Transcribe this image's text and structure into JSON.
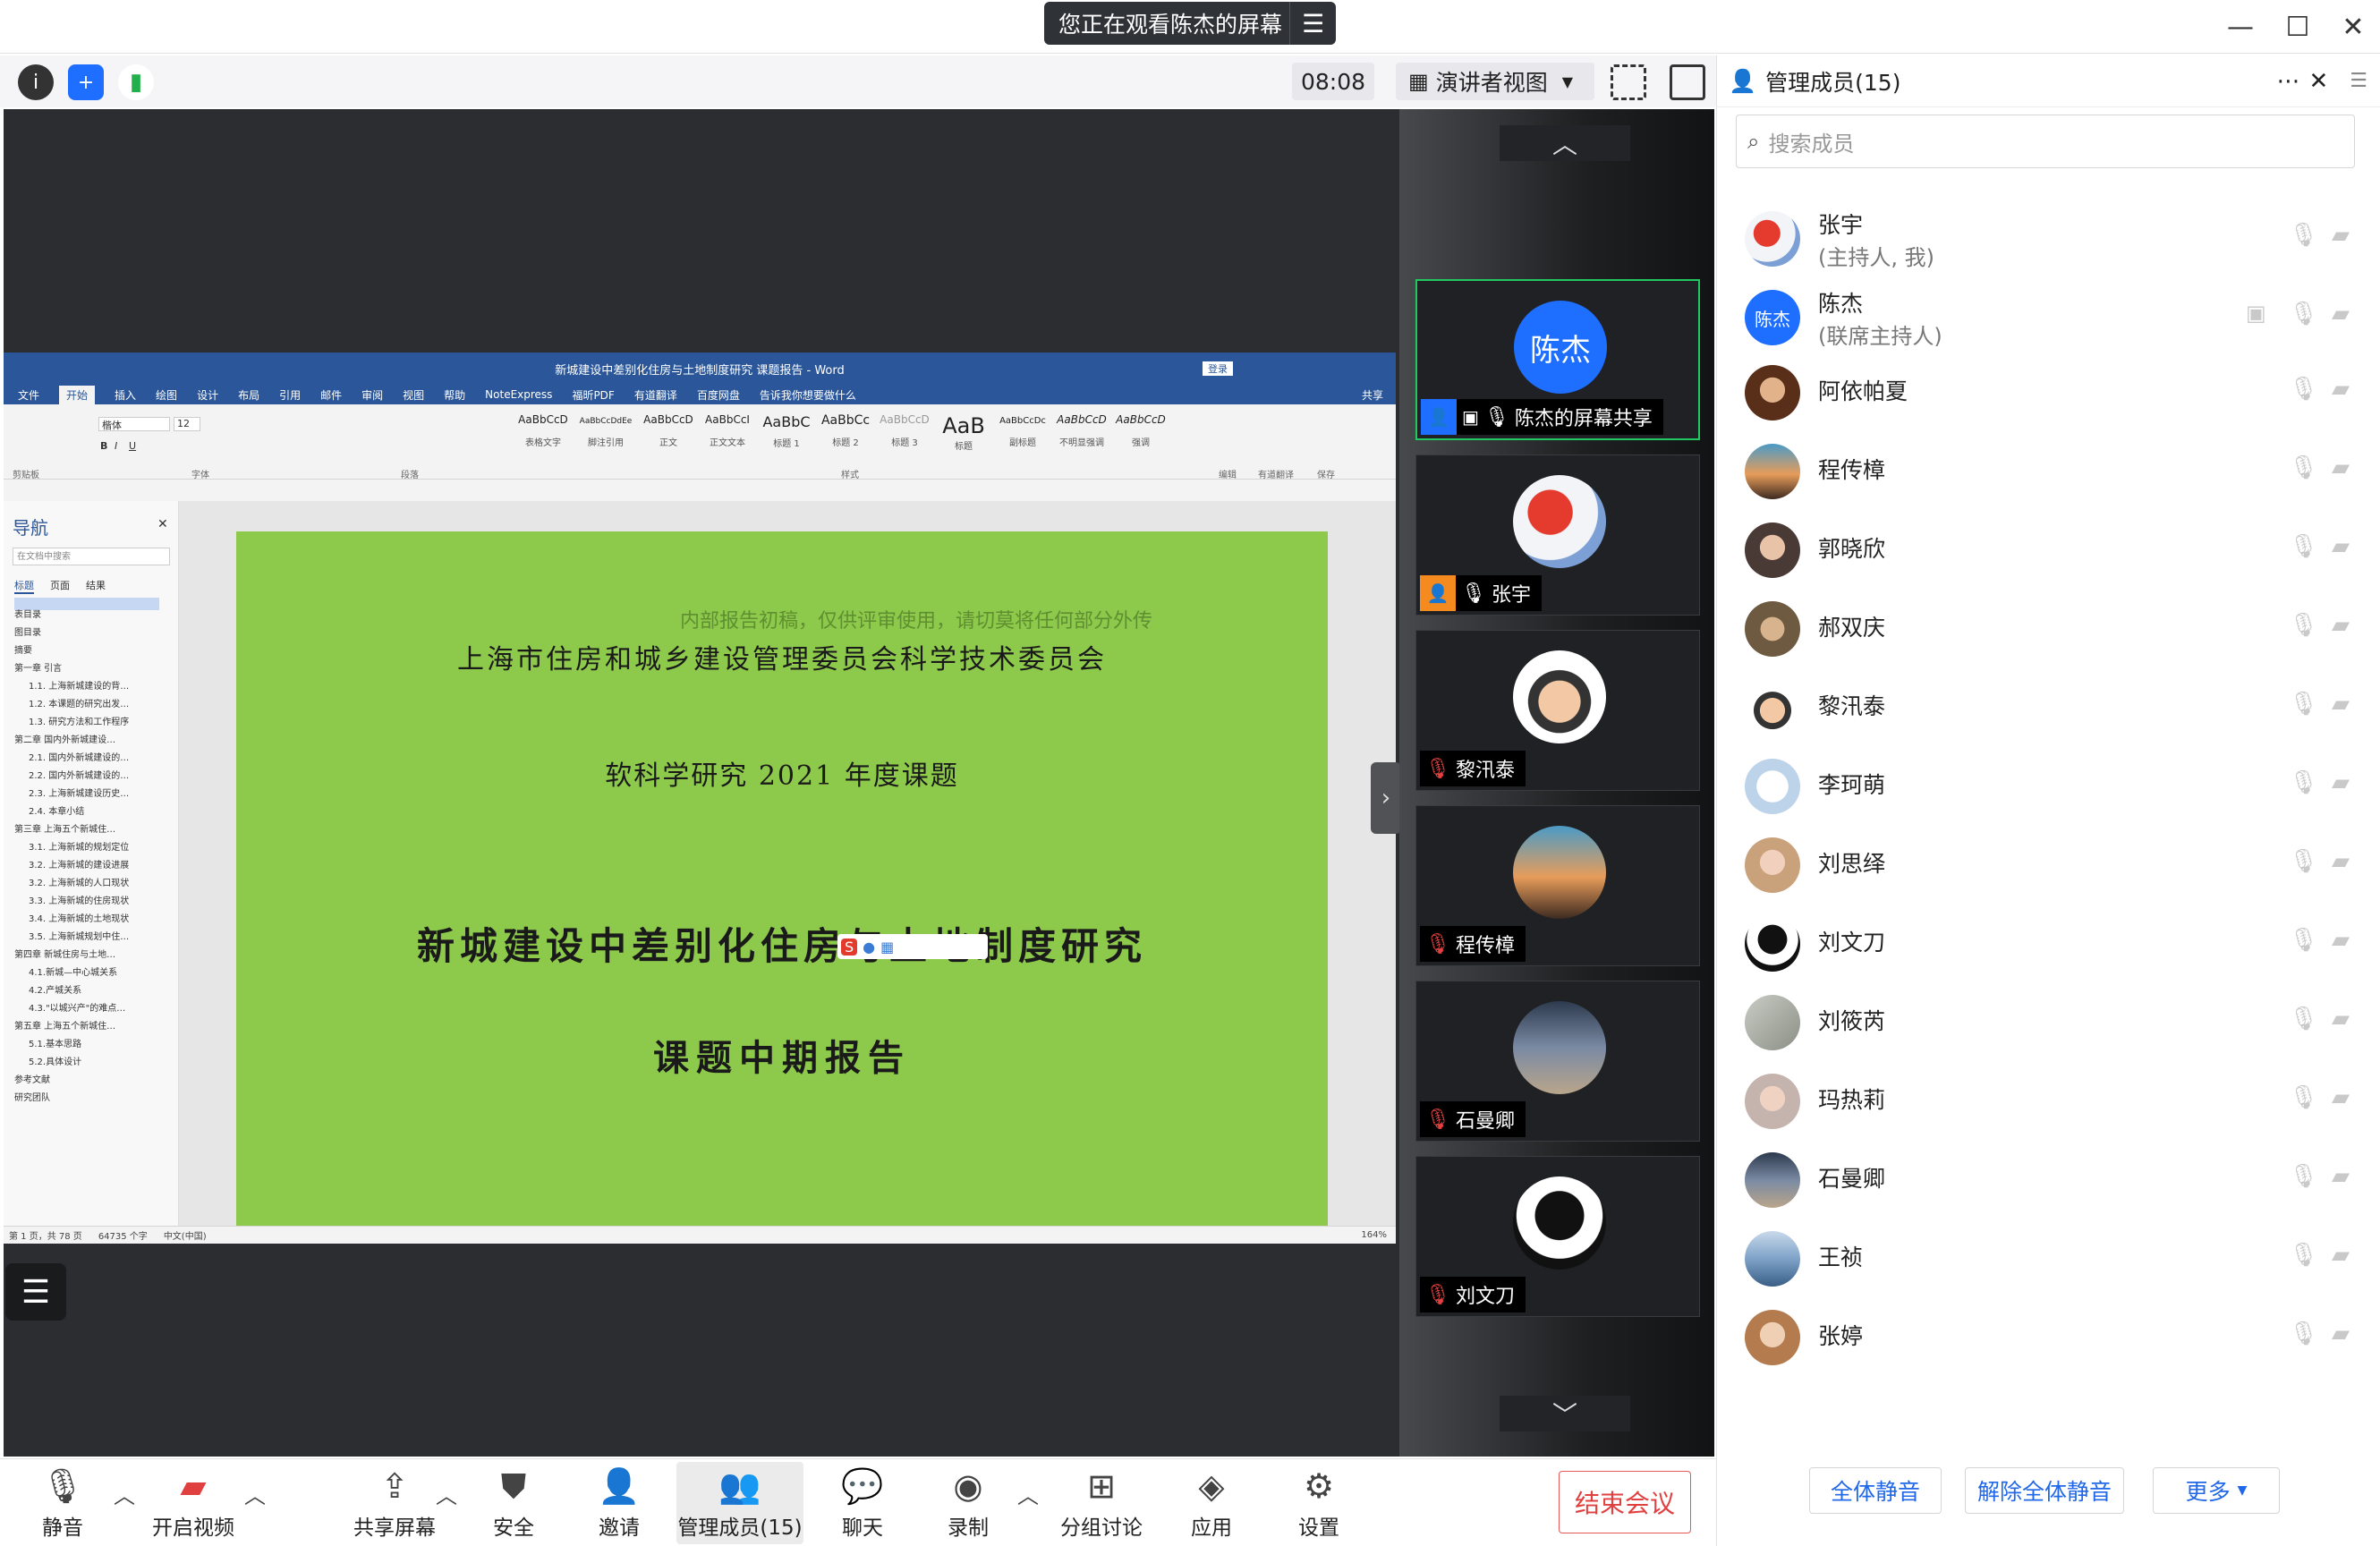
{
  "banner": {
    "text": "您正在观看陈杰的屏幕"
  },
  "toolbar": {
    "timer": "08:08",
    "view_mode": "演讲者视图"
  },
  "members_panel": {
    "title": "管理成员(15)",
    "search_placeholder": "搜索成员",
    "members": [
      {
        "name": "张宇",
        "role": "(主持人, 我)"
      },
      {
        "name": "陈杰",
        "role": "(联席主持人)",
        "avatar_text": "陈杰"
      },
      {
        "name": "阿依帕夏"
      },
      {
        "name": "程传樟"
      },
      {
        "name": "郭晓欣"
      },
      {
        "name": "郝双庆"
      },
      {
        "name": "黎汛泰"
      },
      {
        "name": "李珂萌"
      },
      {
        "name": "刘思绎"
      },
      {
        "name": "刘文刀"
      },
      {
        "name": "刘筱芮"
      },
      {
        "name": "玛热莉"
      },
      {
        "name": "石曼卿"
      },
      {
        "name": "王祯"
      },
      {
        "name": "张婷"
      }
    ],
    "buttons": {
      "mute_all": "全体静音",
      "unmute_all": "解除全体静音",
      "more": "更多"
    }
  },
  "gallery": {
    "tiles": [
      {
        "label": "陈杰的屏幕共享",
        "avatar_text": "陈杰"
      },
      {
        "label": "张宇"
      },
      {
        "label": "黎汛泰"
      },
      {
        "label": "程传樟"
      },
      {
        "label": "石曼卿"
      },
      {
        "label": "刘文刀"
      }
    ]
  },
  "word": {
    "title": "新城建设中差别化住房与土地制度研究 课题报告 - Word",
    "signin": "登录",
    "share": "共享",
    "tabs": [
      "文件",
      "开始",
      "插入",
      "绘图",
      "设计",
      "布局",
      "引用",
      "邮件",
      "审阅",
      "视图",
      "帮助",
      "NoteExpress",
      "福昕PDF",
      "有道翻译",
      "百度网盘",
      "告诉我你想要做什么"
    ],
    "font_name": "楷体",
    "font_size": "12",
    "groups": [
      "剪贴板",
      "字体",
      "段落",
      "样式",
      "编辑",
      "有道翻译",
      "保存"
    ],
    "styles": [
      {
        "preview": "AaBbCcD",
        "name": "表格文字"
      },
      {
        "preview": "AaBbCcDdEe",
        "name": "脚注引用"
      },
      {
        "preview": "AaBbCcD",
        "name": "正文"
      },
      {
        "preview": "AaBbCcI",
        "name": "正文文本"
      },
      {
        "preview": "AaBbC",
        "name": "标题 1"
      },
      {
        "preview": "AaBbCc",
        "name": "标题 2"
      },
      {
        "preview": "AaBbCcD",
        "name": "标题 3"
      },
      {
        "preview": "AaB",
        "name": "标题"
      },
      {
        "preview": "AaBbCcDc",
        "name": "副标题"
      },
      {
        "preview": "AaBbCcD",
        "name": "不明显强调"
      },
      {
        "preview": "AaBbCcD",
        "name": "强调"
      }
    ],
    "nav": {
      "title": "导航",
      "search_placeholder": "在文档中搜索",
      "tabs": [
        "标题",
        "页面",
        "结果"
      ],
      "items": [
        "表目录",
        "图目录",
        "摘要",
        "第一章 引言",
        "1.1. 上海新城建设的背…",
        "1.2. 本课题的研究出发…",
        "1.3. 研究方法和工作程序",
        "第二章 国内外新城建设…",
        "2.1. 国内外新城建设的…",
        "2.2. 国内外新城建设的…",
        "2.3. 上海新城建设历史…",
        "2.4. 本章小结",
        "第三章 上海五个新城住…",
        "3.1. 上海新城的规划定位",
        "3.2. 上海新城的建设进展",
        "3.2. 上海新城的人口现状",
        "3.3. 上海新城的住房现状",
        "3.4. 上海新城的土地现状",
        "3.5. 上海新城规划中住…",
        "第四章 新城住房与土地…",
        "4.1.新城—中心城关系",
        "4.2.产城关系",
        "4.3.\"以城兴产\"的难点…",
        "第五章 上海五个新城住…",
        "5.1.基本思路",
        "5.2.具体设计",
        "参考文献",
        "研究团队"
      ]
    },
    "document": {
      "watermark": "内部报告初稿，仅供评审使用，请切莫将任何部分外传",
      "org": "上海市住房和城乡建设管理委员会科学技术委员会",
      "project": "软科学研究 2021 年度课题",
      "title": "新城建设中差别化住房与土地制度研究",
      "subtitle": "课题中期报告"
    },
    "status": {
      "page": "第 1 页，共 78 页",
      "words": "64735 个字",
      "lang": "中文(中国)",
      "zoom": "164%"
    }
  },
  "bottom_bar": {
    "mute": "静音",
    "video": "开启视频",
    "share": "共享屏幕",
    "security": "安全",
    "invite": "邀请",
    "manage": "管理成员(15)",
    "chat": "聊天",
    "record": "录制",
    "breakout": "分组讨论",
    "apps": "应用",
    "settings": "设置",
    "end": "结束会议"
  },
  "colors": {
    "accent": "#1e6fff",
    "doc_bg": "#8dc94b",
    "word_blue": "#2b579a",
    "active_border": "#21c760",
    "end_red": "#e14040"
  }
}
